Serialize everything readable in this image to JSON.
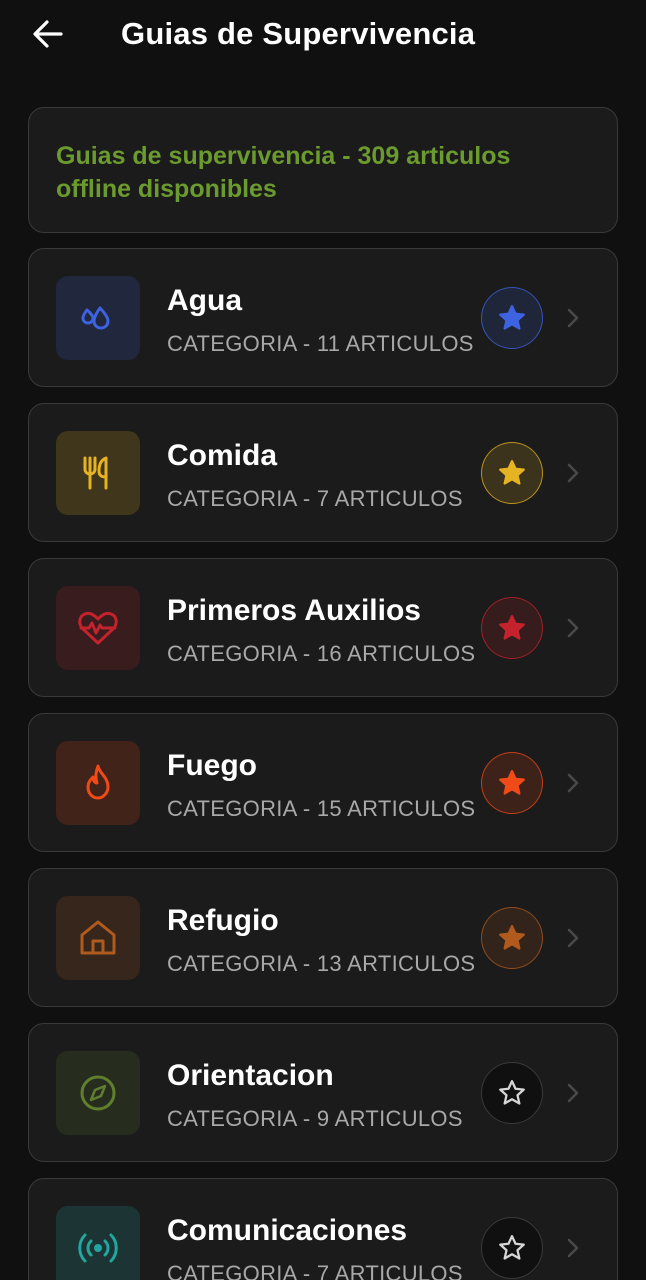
{
  "header": {
    "title": "Guias de Supervivencia",
    "back_icon": "arrow-left-icon"
  },
  "banner": {
    "text": "Guias de supervivencia - 309 articulos offline disponibles",
    "color": "#6b9a2e"
  },
  "categories": [
    {
      "name": "Agua",
      "subtitle": "CATEGORIA - 11 ARTICULOS",
      "icon": "water-drops-icon",
      "accent": "#3d63e0",
      "favorite": true
    },
    {
      "name": "Comida",
      "subtitle": "CATEGORIA - 7 ARTICULOS",
      "icon": "utensils-icon",
      "accent": "#e6b322",
      "favorite": true
    },
    {
      "name": "Primeros Auxilios",
      "subtitle": "CATEGORIA - 16 ARTICULOS",
      "icon": "heart-pulse-icon",
      "accent": "#c4232d",
      "favorite": true
    },
    {
      "name": "Fuego",
      "subtitle": "CATEGORIA - 15 ARTICULOS",
      "icon": "flame-icon",
      "accent": "#f04a18",
      "favorite": true
    },
    {
      "name": "Refugio",
      "subtitle": "CATEGORIA - 13 ARTICULOS",
      "icon": "house-icon",
      "accent": "#b05a1e",
      "favorite": true
    },
    {
      "name": "Orientacion",
      "subtitle": "CATEGORIA - 9 ARTICULOS",
      "icon": "compass-icon",
      "accent": "#5f7f2e",
      "favorite": false
    },
    {
      "name": "Comunicaciones",
      "subtitle": "CATEGORIA - 7 ARTICULOS",
      "icon": "radio-signal-icon",
      "accent": "#22a6a0",
      "favorite": false
    }
  ]
}
